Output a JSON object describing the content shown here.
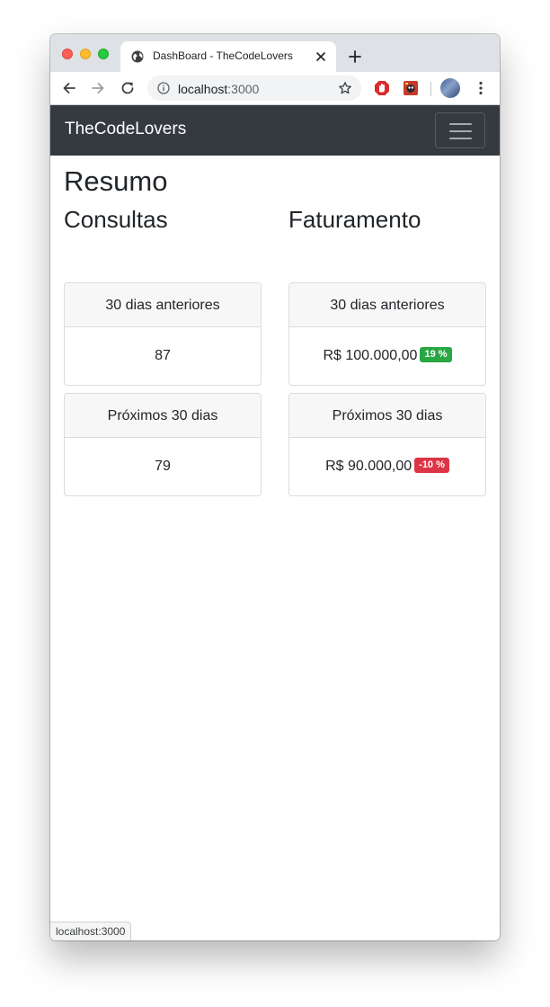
{
  "browser": {
    "tab_title": "DashBoard - TheCodeLovers",
    "url_host": "localhost",
    "url_port": ":3000",
    "status_text": "localhost:3000"
  },
  "navbar": {
    "brand": "TheCodeLovers",
    "bg_color": "#343a40"
  },
  "page": {
    "title": "Resumo",
    "sections": [
      {
        "title": "Consultas",
        "cards": [
          {
            "header": "30 dias anteriores",
            "value": "87"
          },
          {
            "header": "Próximos 30 dias",
            "value": "79"
          }
        ]
      },
      {
        "title": "Faturamento",
        "cards": [
          {
            "header": "30 dias anteriores",
            "value": "R$ 100.000,00",
            "badge": "19 %",
            "badge_color": "#28a745"
          },
          {
            "header": "Próximos 30 dias",
            "value": "R$ 90.000,00",
            "badge": "-10 %",
            "badge_color": "#dc3545"
          }
        ]
      }
    ]
  },
  "icons": {
    "tab_favicon": "globe-icon",
    "tab_close": "close-icon",
    "new_tab": "plus-icon",
    "back": "arrow-left-icon",
    "forward": "arrow-right-icon",
    "reload": "reload-icon",
    "site_info": "info-icon",
    "bookmark": "star-icon",
    "ext1": "adblock-icon",
    "ext2": "extension-icon",
    "menu": "kebab-menu-icon",
    "navbar_toggler": "hamburger-icon"
  }
}
